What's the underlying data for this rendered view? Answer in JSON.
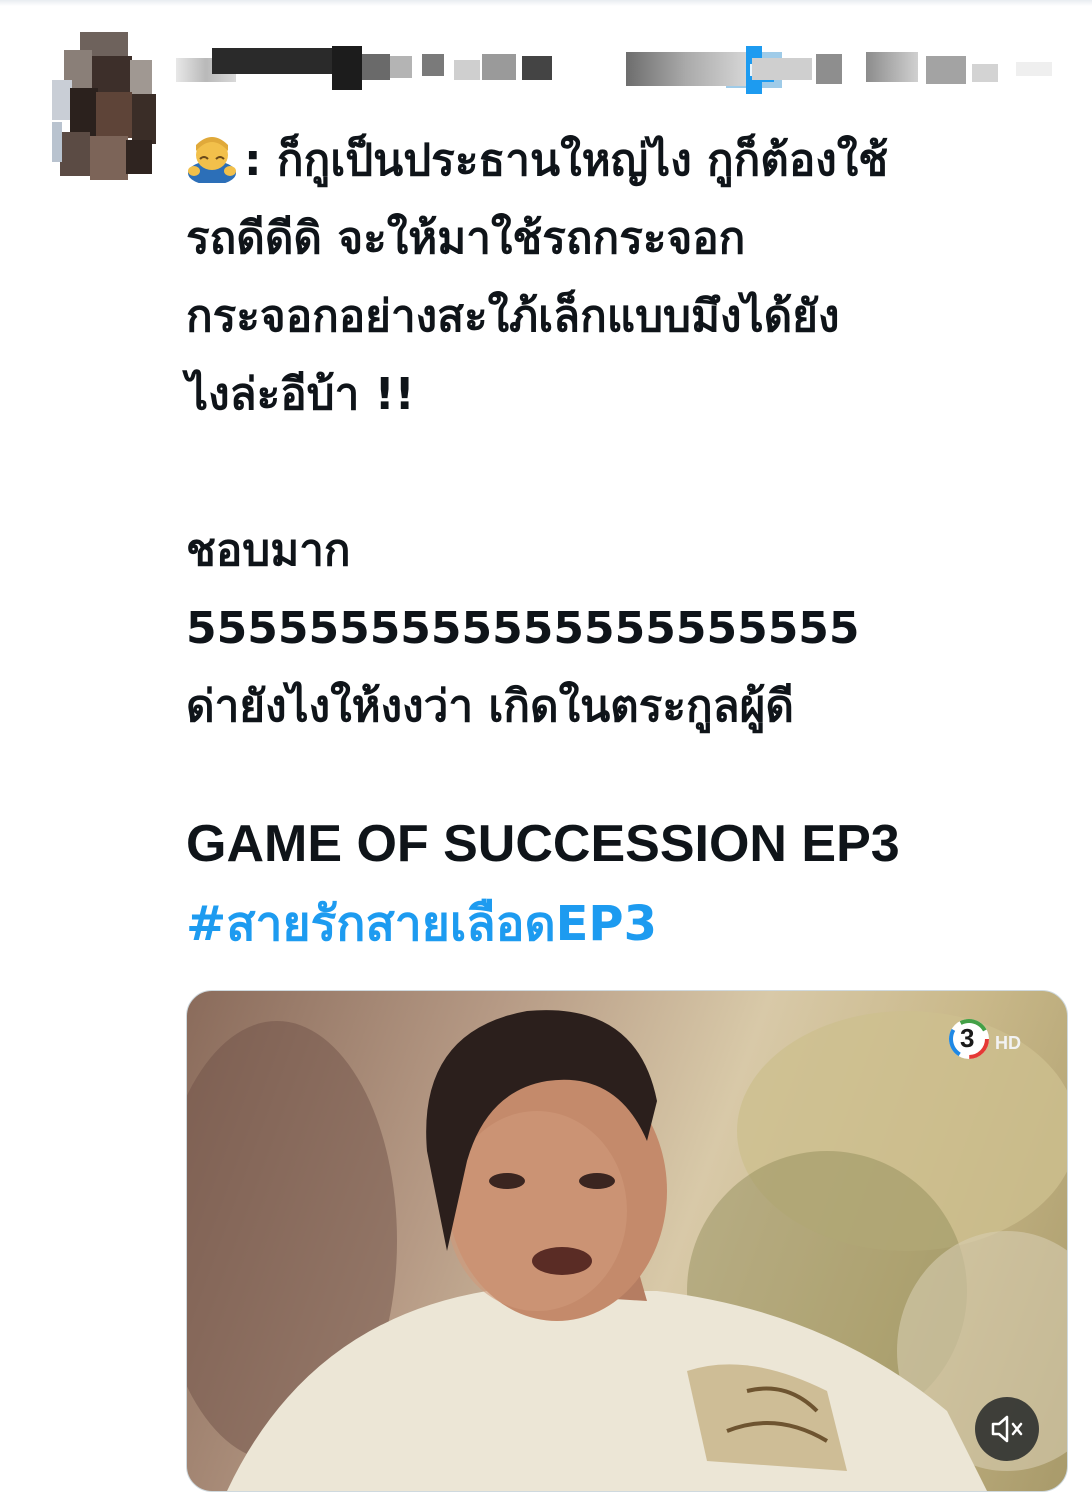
{
  "tweet": {
    "text_lines": [
      "ก็กูเป็นประธานใหญ่ไง กูก็ต้องใช้",
      "รถดีดีดิ จะให้มาใช้รถกระจอก",
      "กระจอกอย่างสะใภ้เล็กแบบมึงได้ยัง",
      "ไงล่ะอีบ้า !!",
      "",
      "ชอบมาก",
      "5555555555555555555555",
      "ด่ายังไงให้งงว่า เกิดในตระกูลผู้ดี"
    ],
    "speaker_prefix": ": ",
    "speaker_emoji": "bowing-person-emoji",
    "title": "GAME OF SUCCESSION EP3",
    "hashtag": "#สายรักสายเลือดEP3"
  },
  "author": {
    "display_name": "",
    "handle": "",
    "verified_icon": "verified-badge-icon",
    "avatar_redacted": true
  },
  "media": {
    "type": "video",
    "channel_logo": "channel-3-hd-logo",
    "logo_text": "HD",
    "mute_icon": "volume-muted-icon"
  },
  "colors": {
    "text": "#0f1419",
    "hashtag": "#1d9bf0",
    "badge": "#1d9bf0"
  }
}
